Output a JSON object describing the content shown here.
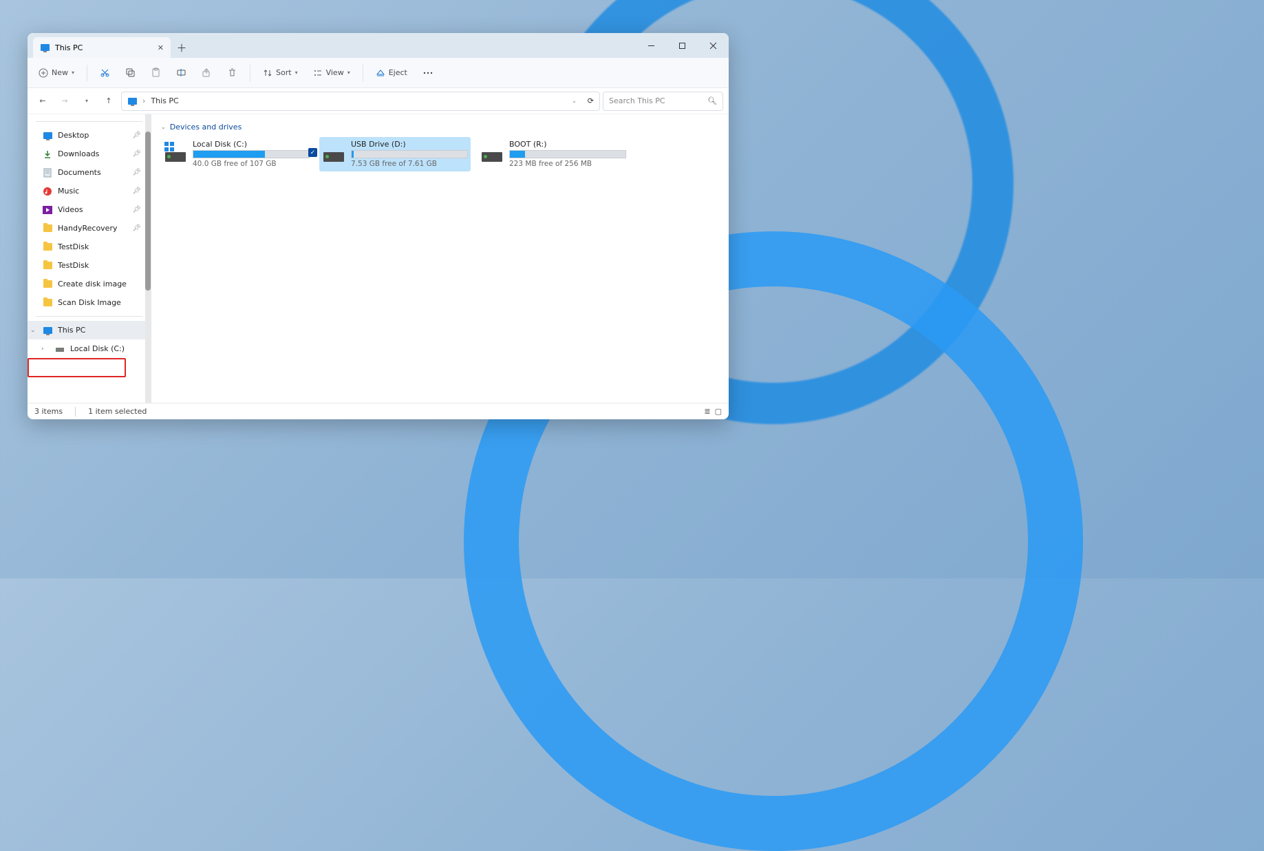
{
  "tab": {
    "title": "This PC"
  },
  "toolbar": {
    "new_label": "New",
    "sort_label": "Sort",
    "view_label": "View",
    "eject_label": "Eject"
  },
  "breadcrumb": {
    "root": "This PC"
  },
  "search": {
    "placeholder": "Search This PC"
  },
  "sidebar": {
    "items": [
      {
        "label": "Desktop",
        "icon": "desktop",
        "pinned": true
      },
      {
        "label": "Downloads",
        "icon": "download",
        "pinned": true
      },
      {
        "label": "Documents",
        "icon": "document",
        "pinned": true
      },
      {
        "label": "Music",
        "icon": "music",
        "pinned": true
      },
      {
        "label": "Videos",
        "icon": "video",
        "pinned": true
      },
      {
        "label": "HandyRecovery",
        "icon": "folder",
        "pinned": true
      },
      {
        "label": "TestDisk",
        "icon": "folder",
        "pinned": false
      },
      {
        "label": "TestDisk",
        "icon": "folder",
        "pinned": false
      },
      {
        "label": "Create disk image",
        "icon": "folder",
        "pinned": false
      },
      {
        "label": "Scan Disk Image",
        "icon": "folder",
        "pinned": false
      }
    ],
    "tree": {
      "this_pc": "This PC",
      "local_disk": "Local Disk (C:)"
    }
  },
  "content": {
    "section_title": "Devices and drives",
    "drives": [
      {
        "name": "Local Disk (C:)",
        "free_text": "40.0 GB free of 107 GB",
        "fill_pct": 62,
        "selected": false
      },
      {
        "name": "USB Drive (D:)",
        "free_text": "7.53 GB free of 7.61 GB",
        "fill_pct": 2,
        "selected": true
      },
      {
        "name": "BOOT (R:)",
        "free_text": "223 MB free of 256 MB",
        "fill_pct": 13,
        "selected": false
      }
    ]
  },
  "status": {
    "count": "3 items",
    "selected": "1 item selected"
  }
}
